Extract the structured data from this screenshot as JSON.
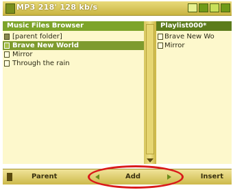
{
  "window": {
    "title": "MP3 218' 128 kb/s"
  },
  "status_icons": [
    "battery-icon",
    "signal-icon",
    "storage-icon",
    "clock-icon"
  ],
  "left_panel": {
    "header": "Music Files Browser",
    "items": [
      {
        "label": "[parent folder]",
        "icon": "folder-icon",
        "selected": false
      },
      {
        "label": "Brave New World",
        "icon": "file-icon",
        "selected": true
      },
      {
        "label": "Mirror",
        "icon": "file-icon",
        "selected": false
      },
      {
        "label": "Through the rain",
        "icon": "file-icon",
        "selected": false
      }
    ]
  },
  "right_panel": {
    "header": "Playlist000*",
    "items": [
      {
        "label": "Brave New Wo",
        "icon": "file-icon"
      },
      {
        "label": "Mirror",
        "icon": "file-icon"
      }
    ]
  },
  "softkeys": {
    "left": "Parent",
    "center": "Add",
    "right": "Insert"
  },
  "colors": {
    "accent": "#7e9b2e",
    "panel_bg": "#fdf8cc",
    "bar": "#d8c760",
    "highlight": "#d91a1a"
  }
}
